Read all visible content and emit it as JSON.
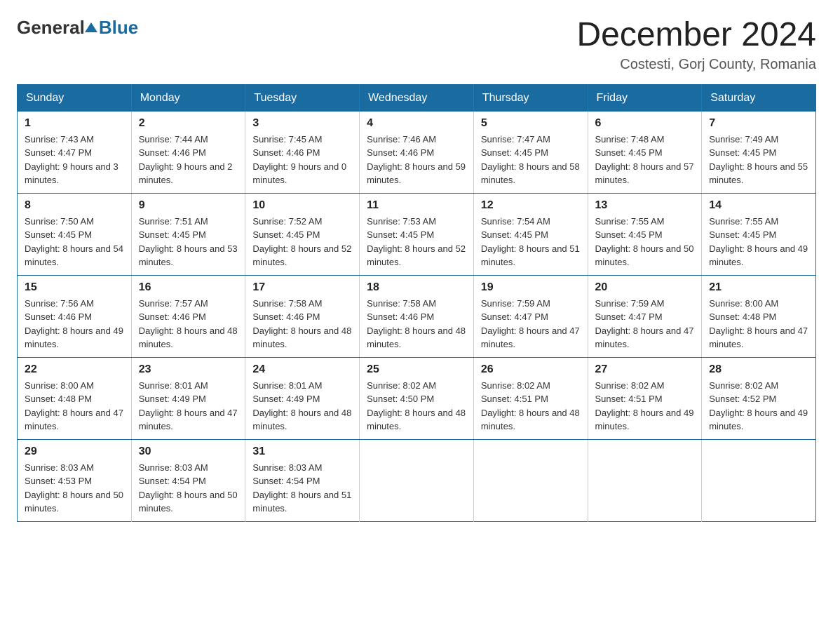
{
  "logo": {
    "general": "General",
    "blue": "Blue"
  },
  "header": {
    "month_year": "December 2024",
    "location": "Costesti, Gorj County, Romania"
  },
  "days_of_week": [
    "Sunday",
    "Monday",
    "Tuesday",
    "Wednesday",
    "Thursday",
    "Friday",
    "Saturday"
  ],
  "weeks": [
    [
      {
        "day": "1",
        "sunrise": "7:43 AM",
        "sunset": "4:47 PM",
        "daylight": "9 hours and 3 minutes."
      },
      {
        "day": "2",
        "sunrise": "7:44 AM",
        "sunset": "4:46 PM",
        "daylight": "9 hours and 2 minutes."
      },
      {
        "day": "3",
        "sunrise": "7:45 AM",
        "sunset": "4:46 PM",
        "daylight": "9 hours and 0 minutes."
      },
      {
        "day": "4",
        "sunrise": "7:46 AM",
        "sunset": "4:46 PM",
        "daylight": "8 hours and 59 minutes."
      },
      {
        "day": "5",
        "sunrise": "7:47 AM",
        "sunset": "4:45 PM",
        "daylight": "8 hours and 58 minutes."
      },
      {
        "day": "6",
        "sunrise": "7:48 AM",
        "sunset": "4:45 PM",
        "daylight": "8 hours and 57 minutes."
      },
      {
        "day": "7",
        "sunrise": "7:49 AM",
        "sunset": "4:45 PM",
        "daylight": "8 hours and 55 minutes."
      }
    ],
    [
      {
        "day": "8",
        "sunrise": "7:50 AM",
        "sunset": "4:45 PM",
        "daylight": "8 hours and 54 minutes."
      },
      {
        "day": "9",
        "sunrise": "7:51 AM",
        "sunset": "4:45 PM",
        "daylight": "8 hours and 53 minutes."
      },
      {
        "day": "10",
        "sunrise": "7:52 AM",
        "sunset": "4:45 PM",
        "daylight": "8 hours and 52 minutes."
      },
      {
        "day": "11",
        "sunrise": "7:53 AM",
        "sunset": "4:45 PM",
        "daylight": "8 hours and 52 minutes."
      },
      {
        "day": "12",
        "sunrise": "7:54 AM",
        "sunset": "4:45 PM",
        "daylight": "8 hours and 51 minutes."
      },
      {
        "day": "13",
        "sunrise": "7:55 AM",
        "sunset": "4:45 PM",
        "daylight": "8 hours and 50 minutes."
      },
      {
        "day": "14",
        "sunrise": "7:55 AM",
        "sunset": "4:45 PM",
        "daylight": "8 hours and 49 minutes."
      }
    ],
    [
      {
        "day": "15",
        "sunrise": "7:56 AM",
        "sunset": "4:46 PM",
        "daylight": "8 hours and 49 minutes."
      },
      {
        "day": "16",
        "sunrise": "7:57 AM",
        "sunset": "4:46 PM",
        "daylight": "8 hours and 48 minutes."
      },
      {
        "day": "17",
        "sunrise": "7:58 AM",
        "sunset": "4:46 PM",
        "daylight": "8 hours and 48 minutes."
      },
      {
        "day": "18",
        "sunrise": "7:58 AM",
        "sunset": "4:46 PM",
        "daylight": "8 hours and 48 minutes."
      },
      {
        "day": "19",
        "sunrise": "7:59 AM",
        "sunset": "4:47 PM",
        "daylight": "8 hours and 47 minutes."
      },
      {
        "day": "20",
        "sunrise": "7:59 AM",
        "sunset": "4:47 PM",
        "daylight": "8 hours and 47 minutes."
      },
      {
        "day": "21",
        "sunrise": "8:00 AM",
        "sunset": "4:48 PM",
        "daylight": "8 hours and 47 minutes."
      }
    ],
    [
      {
        "day": "22",
        "sunrise": "8:00 AM",
        "sunset": "4:48 PM",
        "daylight": "8 hours and 47 minutes."
      },
      {
        "day": "23",
        "sunrise": "8:01 AM",
        "sunset": "4:49 PM",
        "daylight": "8 hours and 47 minutes."
      },
      {
        "day": "24",
        "sunrise": "8:01 AM",
        "sunset": "4:49 PM",
        "daylight": "8 hours and 48 minutes."
      },
      {
        "day": "25",
        "sunrise": "8:02 AM",
        "sunset": "4:50 PM",
        "daylight": "8 hours and 48 minutes."
      },
      {
        "day": "26",
        "sunrise": "8:02 AM",
        "sunset": "4:51 PM",
        "daylight": "8 hours and 48 minutes."
      },
      {
        "day": "27",
        "sunrise": "8:02 AM",
        "sunset": "4:51 PM",
        "daylight": "8 hours and 49 minutes."
      },
      {
        "day": "28",
        "sunrise": "8:02 AM",
        "sunset": "4:52 PM",
        "daylight": "8 hours and 49 minutes."
      }
    ],
    [
      {
        "day": "29",
        "sunrise": "8:03 AM",
        "sunset": "4:53 PM",
        "daylight": "8 hours and 50 minutes."
      },
      {
        "day": "30",
        "sunrise": "8:03 AM",
        "sunset": "4:54 PM",
        "daylight": "8 hours and 50 minutes."
      },
      {
        "day": "31",
        "sunrise": "8:03 AM",
        "sunset": "4:54 PM",
        "daylight": "8 hours and 51 minutes."
      },
      null,
      null,
      null,
      null
    ]
  ],
  "labels": {
    "sunrise_prefix": "Sunrise: ",
    "sunset_prefix": "Sunset: ",
    "daylight_prefix": "Daylight: "
  }
}
